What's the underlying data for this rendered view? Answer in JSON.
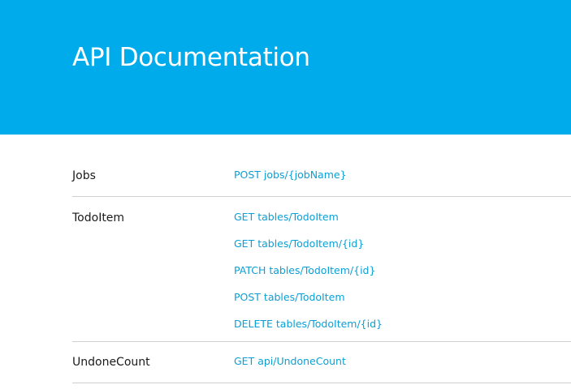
{
  "header": {
    "title": "API Documentation",
    "background_color": "#00abeb"
  },
  "link_color": "#0a9fd6",
  "groups": [
    {
      "name": "Jobs",
      "endpoints": [
        "POST jobs/{jobName}"
      ]
    },
    {
      "name": "TodoItem",
      "endpoints": [
        "GET tables/TodoItem",
        "GET tables/TodoItem/{id}",
        "PATCH tables/TodoItem/{id}",
        "POST tables/TodoItem",
        "DELETE tables/TodoItem/{id}"
      ]
    },
    {
      "name": "UndoneCount",
      "endpoints": [
        "GET api/UndoneCount"
      ]
    }
  ]
}
